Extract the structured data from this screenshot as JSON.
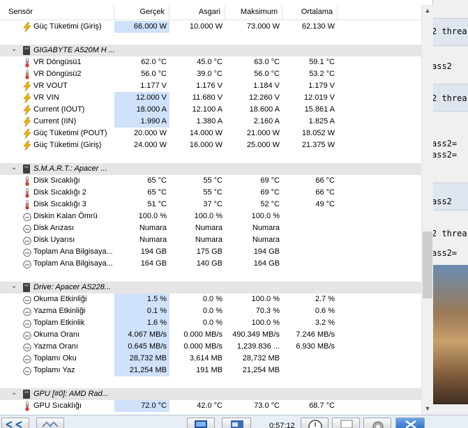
{
  "columns": [
    "Sensör",
    "Gerçek",
    "Asgari",
    "Maksimum",
    "Ortalama"
  ],
  "rows": [
    {
      "type": "sensor",
      "icon": "bolt-icon",
      "name": "Güç Tüketimi (Giriş)",
      "cur": "66.000 W",
      "min": "10.000 W",
      "max": "73.000 W",
      "avg": "62.130 W",
      "hl": true
    },
    {
      "type": "blank"
    },
    {
      "type": "group",
      "icon": "chip-icon",
      "name": "GIGABYTE A520M H ..."
    },
    {
      "type": "sensor",
      "icon": "thermometer-icon",
      "name": "VR Döngüsü1",
      "cur": "62.0 °C",
      "min": "45.0 °C",
      "max": "63.0 °C",
      "avg": "59.1 °C"
    },
    {
      "type": "sensor",
      "icon": "thermometer-icon",
      "name": "VR Döngüsü2",
      "cur": "56.0 °C",
      "min": "39.0 °C",
      "max": "56.0 °C",
      "avg": "53.2 °C"
    },
    {
      "type": "sensor",
      "icon": "bolt-icon",
      "name": "VR VOUT",
      "cur": "1.177 V",
      "min": "1.176 V",
      "max": "1.184 V",
      "avg": "1.179 V"
    },
    {
      "type": "sensor",
      "icon": "bolt-icon",
      "name": "VR VIN",
      "cur": "12.000 V",
      "min": "11.680 V",
      "max": "12.260 V",
      "avg": "12.019 V",
      "hl": true
    },
    {
      "type": "sensor",
      "icon": "bolt-icon",
      "name": "Current (IOUT)",
      "cur": "18.000 A",
      "min": "12.100 A",
      "max": "18.600 A",
      "avg": "15.861 A",
      "hl": true
    },
    {
      "type": "sensor",
      "icon": "bolt-icon",
      "name": "Current (IIN)",
      "cur": "1.990 A",
      "min": "1.380 A",
      "max": "2.160 A",
      "avg": "1.825 A",
      "hl": true
    },
    {
      "type": "sensor",
      "icon": "bolt-icon",
      "name": "Güç Tüketimi (POUT)",
      "cur": "20.000 W",
      "min": "14.000 W",
      "max": "21.000 W",
      "avg": "18.052 W"
    },
    {
      "type": "sensor",
      "icon": "bolt-icon",
      "name": "Güç Tüketimi (Giriş)",
      "cur": "24.000 W",
      "min": "16.000 W",
      "max": "25.000 W",
      "avg": "21.375 W"
    },
    {
      "type": "blank"
    },
    {
      "type": "group",
      "icon": "disk-icon",
      "name": "S.M.A.R.T.: Apacer ..."
    },
    {
      "type": "sensor",
      "icon": "thermometer-icon",
      "name": "Disk Sıcaklığı",
      "cur": "65 °C",
      "min": "55 °C",
      "max": "69 °C",
      "avg": "66 °C"
    },
    {
      "type": "sensor",
      "icon": "thermometer-icon",
      "name": "Disk Sıcaklığı 2",
      "cur": "65 °C",
      "min": "55 °C",
      "max": "69 °C",
      "avg": "66 °C"
    },
    {
      "type": "sensor",
      "icon": "thermometer-icon",
      "name": "Disk Sıcaklığı 3",
      "cur": "51 °C",
      "min": "37 °C",
      "max": "52 °C",
      "avg": "49 °C"
    },
    {
      "type": "sensor",
      "icon": "gauge-icon",
      "name": "Diskin Kalan Ömrü",
      "cur": "100.0 %",
      "min": "100.0 %",
      "max": "100.0 %",
      "avg": ""
    },
    {
      "type": "sensor",
      "icon": "gauge-icon",
      "name": "Disk Arızası",
      "cur": "Numara",
      "min": "Numara",
      "max": "Numara",
      "avg": ""
    },
    {
      "type": "sensor",
      "icon": "gauge-icon",
      "name": "Disk Uyarısı",
      "cur": "Numara",
      "min": "Numara",
      "max": "Numara",
      "avg": ""
    },
    {
      "type": "sensor",
      "icon": "gauge-icon",
      "name": "Toplam Ana Bilgisaya...",
      "cur": "194 GB",
      "min": "175 GB",
      "max": "194 GB",
      "avg": ""
    },
    {
      "type": "sensor",
      "icon": "gauge-icon",
      "name": "Toplam Ana Bilgisaya...",
      "cur": "164 GB",
      "min": "140 GB",
      "max": "164 GB",
      "avg": ""
    },
    {
      "type": "blank"
    },
    {
      "type": "group",
      "icon": "disk-icon",
      "name": "Drive: Apacer AS228..."
    },
    {
      "type": "sensor",
      "icon": "gauge-icon",
      "name": "Okuma Etkinliği",
      "cur": "1.5 %",
      "min": "0.0 %",
      "max": "100.0 %",
      "avg": "2.7 %",
      "hl": true
    },
    {
      "type": "sensor",
      "icon": "gauge-icon",
      "name": "Yazma Etkinliği",
      "cur": "0.1 %",
      "min": "0.0 %",
      "max": "70.3 %",
      "avg": "0.6 %",
      "hl": true
    },
    {
      "type": "sensor",
      "icon": "gauge-icon",
      "name": "Toplam Etkinlik",
      "cur": "1.6 %",
      "min": "0.0 %",
      "max": "100.0 %",
      "avg": "3.2 %",
      "hl": true
    },
    {
      "type": "sensor",
      "icon": "gauge-icon",
      "name": "Okuma Oranı",
      "cur": "4.067 MB/s",
      "min": "0.000 MB/s",
      "max": "490.349 MB/s",
      "avg": "7.246 MB/s",
      "hl": true
    },
    {
      "type": "sensor",
      "icon": "gauge-icon",
      "name": "Yazma Oranı",
      "cur": "0.645 MB/s",
      "min": "0.000 MB/s",
      "max": "1,239.836 ...",
      "avg": "6.930 MB/s",
      "hl": true
    },
    {
      "type": "sensor",
      "icon": "gauge-icon",
      "name": "Toplamı Oku",
      "cur": "28,732 MB",
      "min": "3,614 MB",
      "max": "28,732 MB",
      "avg": "",
      "hl": true
    },
    {
      "type": "sensor",
      "icon": "gauge-icon",
      "name": "Toplamı Yaz",
      "cur": "21,254 MB",
      "min": "191 MB",
      "max": "21,254 MB",
      "avg": "",
      "hl": true
    },
    {
      "type": "blank"
    },
    {
      "type": "group",
      "icon": "chip-icon",
      "name": "GPU [#0]: AMD Rad..."
    },
    {
      "type": "sensor",
      "icon": "thermometer-icon",
      "name": "GPU Sıcaklığı",
      "cur": "72.0 °C",
      "min": "42.0 °C",
      "max": "73.0 °C",
      "avg": "68.7 °C",
      "hl": true
    }
  ],
  "background_texts": [
    "2 threa",
    "ass2",
    "2 threa",
    "ass2=",
    "ass2=",
    "ass2",
    "2 threa",
    "ass2="
  ],
  "clock": "0:57:12",
  "colors": {
    "highlight": "#cfe1fb",
    "group_bg": "#e5e5e5",
    "bolt": "#f0b400"
  }
}
